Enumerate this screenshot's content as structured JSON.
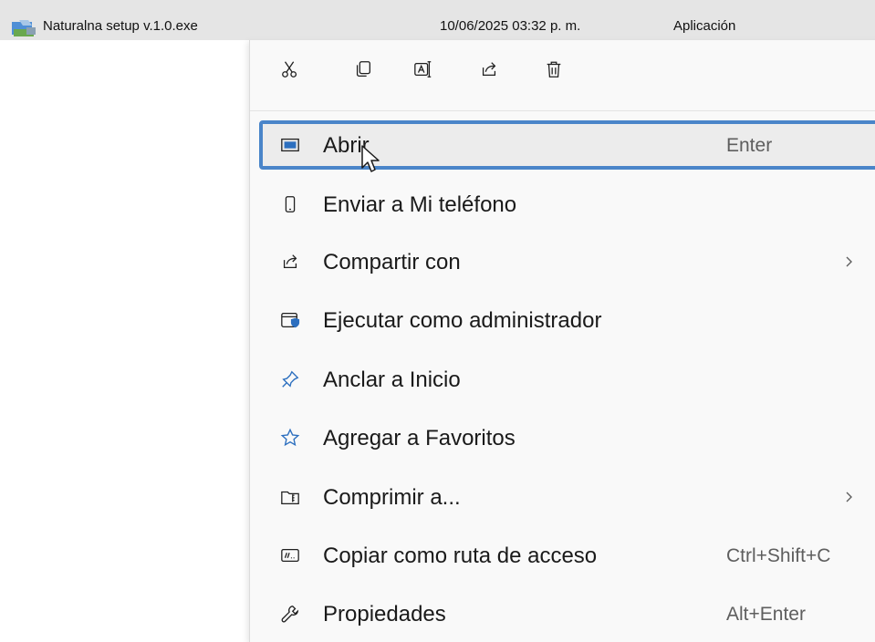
{
  "file": {
    "name": "Naturalna setup v.1.0.exe",
    "date": "10/06/2025 03:32 p. m.",
    "type": "Aplicación",
    "icon": "installer-icon"
  },
  "quick_actions": [
    {
      "name": "cut",
      "icon": "scissors-icon"
    },
    {
      "name": "copy",
      "icon": "copy-icon"
    },
    {
      "name": "rename",
      "icon": "rename-icon"
    },
    {
      "name": "share",
      "icon": "share-icon"
    },
    {
      "name": "delete",
      "icon": "trash-icon"
    }
  ],
  "menu": {
    "items": [
      {
        "label": "Abrir",
        "shortcut": "Enter",
        "icon": "window-open-icon"
      },
      {
        "label": "Enviar a Mi teléfono",
        "icon": "phone-icon"
      },
      {
        "label": "Compartir con",
        "icon": "share-icon",
        "submenu": true
      },
      {
        "label": "Ejecutar como administrador",
        "icon": "shield-window-icon"
      },
      {
        "label": "Anclar a Inicio",
        "icon": "pin-icon"
      },
      {
        "label": "Agregar a Favoritos",
        "icon": "star-icon"
      },
      {
        "label": "Comprimir a...",
        "icon": "zip-folder-icon",
        "submenu": true
      },
      {
        "label": "Copiar como ruta de acceso",
        "shortcut": "Ctrl+Shift+C",
        "icon": "path-icon"
      },
      {
        "label": "Propiedades",
        "shortcut": "Alt+Enter",
        "icon": "wrench-icon"
      }
    ]
  },
  "colors": {
    "focus_outline": "#4a85c9",
    "icon_blue": "#2c6fbf",
    "menu_bg": "#f9f9f9"
  }
}
